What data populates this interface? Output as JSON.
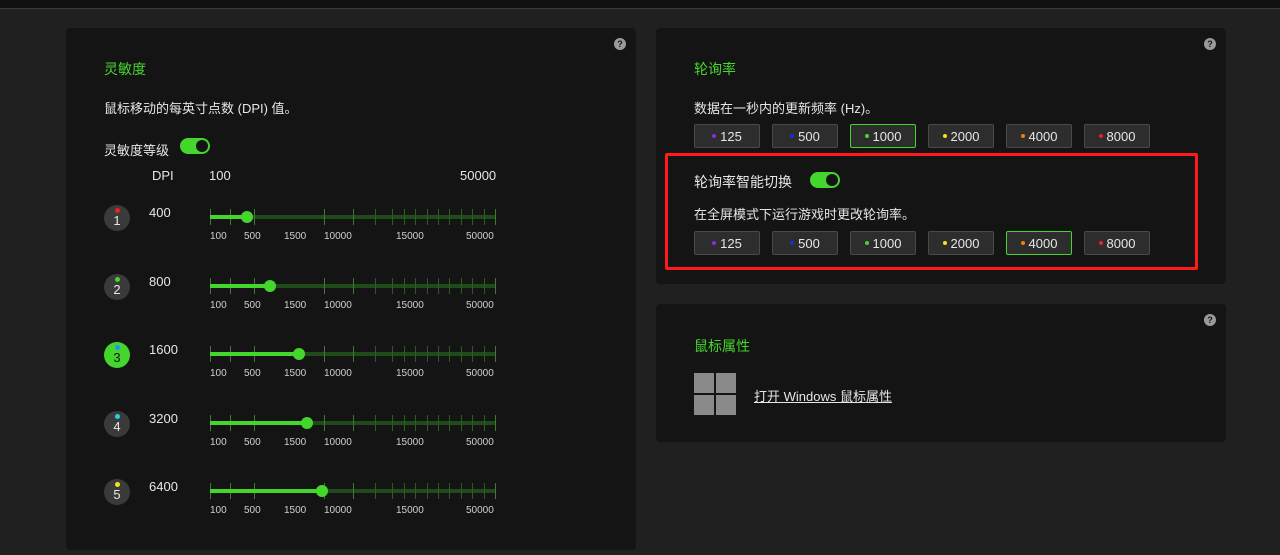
{
  "sensitivity": {
    "title": "灵敏度",
    "description": "鼠标移动的每英寸点数 (DPI) 值。",
    "stages_label": "灵敏度等级",
    "stages_enabled": true,
    "dpi_header": "DPI",
    "range_min": "100",
    "range_max": "50000",
    "scale_labels": [
      "100",
      "500",
      "1500",
      "10000",
      "15000",
      "50000"
    ],
    "help": "?",
    "stages": [
      {
        "number": "1",
        "dpi": "400",
        "dot_color": "#e8202a",
        "active": false,
        "level": 0.13
      },
      {
        "number": "2",
        "dpi": "800",
        "dot_color": "#44d62c",
        "active": false,
        "level": 0.21
      },
      {
        "number": "3",
        "dpi": "1600",
        "dot_color": "#2a8cff",
        "active": true,
        "level": 0.31
      },
      {
        "number": "4",
        "dpi": "3200",
        "dot_color": "#22d3e6",
        "active": false,
        "level": 0.34
      },
      {
        "number": "5",
        "dpi": "6400",
        "dot_color": "#f2e41b",
        "active": false,
        "level": 0.39
      }
    ]
  },
  "polling": {
    "title": "轮询率",
    "description": "数据在一秒内的更新频率 (Hz)。",
    "help": "?",
    "rates": [
      {
        "label": "125",
        "color": "#8b2be2"
      },
      {
        "label": "500",
        "color": "#1a2bd6"
      },
      {
        "label": "1000",
        "color": "#44d62c"
      },
      {
        "label": "2000",
        "color": "#f2e41b"
      },
      {
        "label": "4000",
        "color": "#f07c14"
      },
      {
        "label": "8000",
        "color": "#e8202a"
      }
    ],
    "selected": "1000",
    "smart_switch": {
      "title": "轮询率智能切换",
      "enabled": true,
      "description": "在全屏模式下运行游戏时更改轮询率。",
      "selected": "4000"
    }
  },
  "mouse_props": {
    "title": "鼠标属性",
    "link": "打开 Windows 鼠标属性",
    "help": "?"
  }
}
